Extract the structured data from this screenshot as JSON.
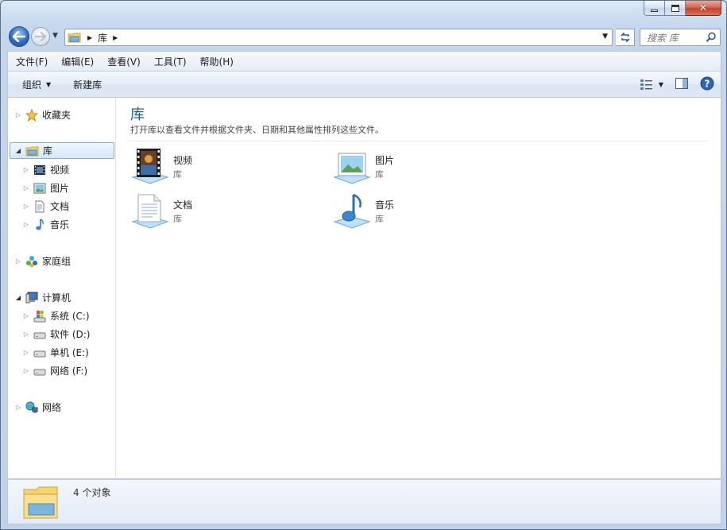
{
  "address": {
    "crumb": "库"
  },
  "search": {
    "placeholder": "搜索 库"
  },
  "menu": [
    "文件(F)",
    "编辑(E)",
    "查看(V)",
    "工具(T)",
    "帮助(H)"
  ],
  "toolbar": {
    "organize": "组织",
    "new_library": "新建库"
  },
  "nav": {
    "favorites": "收藏夹",
    "libraries": "库",
    "lib_items": [
      "视频",
      "图片",
      "文档",
      "音乐"
    ],
    "homegroup": "家庭组",
    "computer": "计算机",
    "drives": [
      "系统 (C:)",
      "软件 (D:)",
      "单机 (E:)",
      "网络 (F:)"
    ],
    "network": "网络"
  },
  "main": {
    "title": "库",
    "subtitle": "打开库以查看文件并根据文件夹、日期和其他属性排列这些文件。",
    "tiles": [
      {
        "name": "视频",
        "kind": "库"
      },
      {
        "name": "图片",
        "kind": "库"
      },
      {
        "name": "文档",
        "kind": "库"
      },
      {
        "name": "音乐",
        "kind": "库"
      }
    ]
  },
  "details": {
    "count": "4 个对象"
  },
  "colors": {
    "accent": "#1e5a8c",
    "selection": "#d6e7fb",
    "chrome": "#c6d8ee"
  }
}
